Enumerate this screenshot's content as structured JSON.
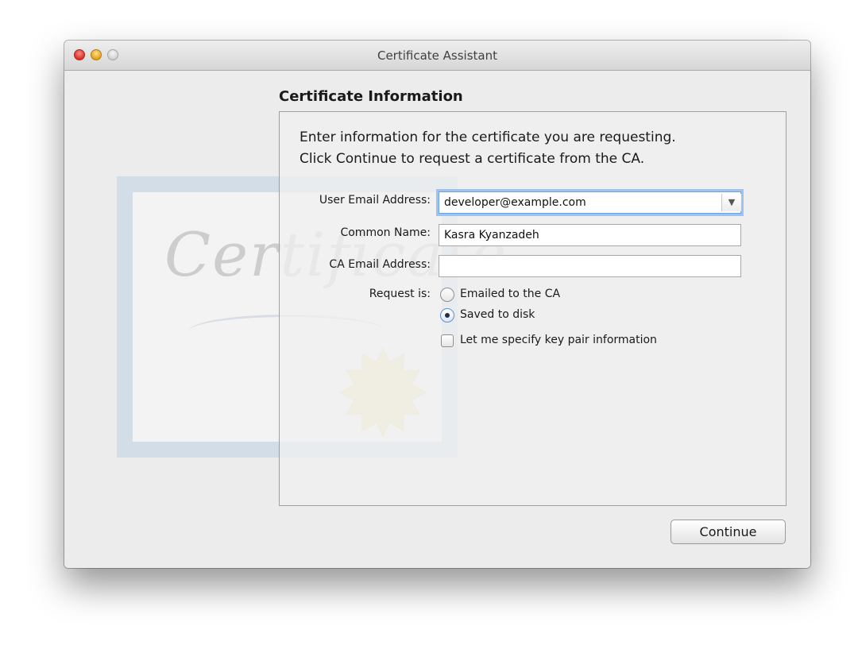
{
  "window": {
    "title": "Certificate Assistant"
  },
  "section": {
    "title": "Certificate Information"
  },
  "intro": {
    "line1": "Enter information for the certificate you are requesting.",
    "line2": "Click Continue to request a certificate from the CA."
  },
  "form": {
    "user_email_label": "User Email Address:",
    "user_email_value": "developer@example.com",
    "common_name_label": "Common Name:",
    "common_name_value": "Kasra Kyanzadeh",
    "ca_email_label": "CA Email Address:",
    "ca_email_value": "",
    "request_is_label": "Request is:",
    "options": {
      "emailed_label": "Emailed to the CA",
      "saved_label": "Saved to disk",
      "key_pair_label": "Let me specify key pair information"
    },
    "selected_option": "Saved to disk",
    "key_pair_checked": false
  },
  "buttons": {
    "continue_label": "Continue"
  },
  "background_art": {
    "watermark_text": "Certificate"
  },
  "colors": {
    "close": "#d9302a",
    "minimize": "#e1a11c",
    "zoom": "#cfcfcf",
    "focus_ring": "#9ec3ef"
  }
}
